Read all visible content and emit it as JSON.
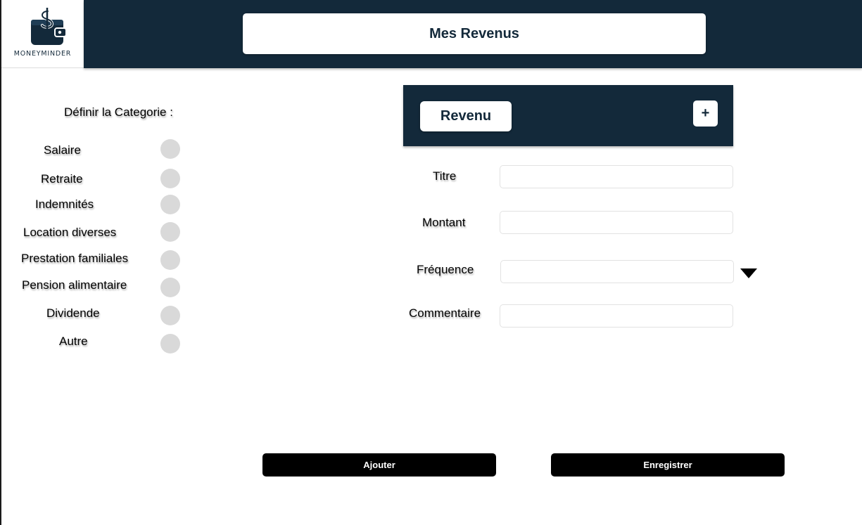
{
  "app": {
    "logo_text": "MONEYMINDER",
    "title": "Mes Revenus"
  },
  "sidebar": {
    "heading": "Définir la Categorie :",
    "categories": [
      {
        "label": "Salaire"
      },
      {
        "label": "Retraite"
      },
      {
        "label": "Indemnités"
      },
      {
        "label": "Location diverses"
      },
      {
        "label": "Prestation familiales"
      },
      {
        "label": "Pension alimentaire"
      },
      {
        "label": "Dividende"
      },
      {
        "label": "Autre"
      }
    ]
  },
  "panel": {
    "revenu_label": "Revenu",
    "plus_label": "+"
  },
  "form": {
    "titre_label": "Titre",
    "titre_value": "",
    "montant_label": "Montant",
    "montant_value": "",
    "frequence_label": "Fréquence",
    "frequence_value": "",
    "commentaire_label": "Commentaire",
    "commentaire_value": ""
  },
  "actions": {
    "ajouter_label": "Ajouter",
    "enregistrer_label": "Enregistrer"
  },
  "colors": {
    "primary_dark": "#13293a",
    "radio_gray": "#d9d9d9",
    "button_black": "#000000"
  }
}
